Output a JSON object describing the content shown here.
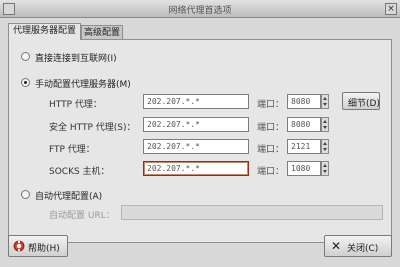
{
  "window": {
    "title": "网络代理首选项"
  },
  "tabs": [
    {
      "label": "代理服务器配置"
    },
    {
      "label": "高级配置"
    }
  ],
  "options": {
    "direct": "直接连接到互联网(I)",
    "manual": "手动配置代理服务器(M)",
    "auto": "自动代理配置(A)"
  },
  "manual": {
    "rows": [
      {
        "label": "HTTP 代理：",
        "host": "202.207.*.*",
        "port_label": "端口：",
        "port": "8080"
      },
      {
        "label": "安全 HTTP 代理(S)：",
        "host": "202.207.*.*",
        "port_label": "端口：",
        "port": "8080"
      },
      {
        "label": "FTP 代理：",
        "host": "202.207.*.*",
        "port_label": "端口：",
        "port": "2121"
      },
      {
        "label": "SOCKS 主机：",
        "host": "202.207.*.*",
        "port_label": "端口：",
        "port": "1080"
      }
    ],
    "details_button": "细节(D)"
  },
  "auto": {
    "url_label": "自动配置 URL：",
    "url_value": ""
  },
  "footer": {
    "help_button": "帮助(H)",
    "close_button": "关闭(C)"
  }
}
